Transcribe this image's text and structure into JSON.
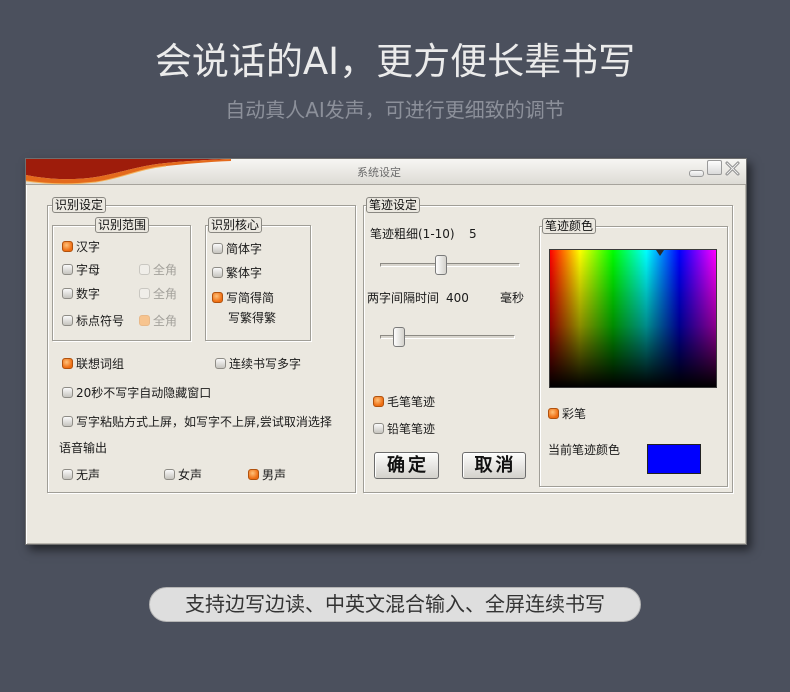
{
  "headline": "会说话的AI，更方便长辈书写",
  "subheadline": "自动真人AI发声，可进行更细致的调节",
  "dialog": {
    "title": "系统设定",
    "window_controls": {
      "minimize_icon": "minimize-icon",
      "maximize_icon": "maximize-icon",
      "close_icon": "close-icon"
    },
    "recognition": {
      "title": "识别设定",
      "range": {
        "title": "识别范围",
        "hanzi": {
          "label": "汉字",
          "checked": true
        },
        "letters": {
          "label": "字母",
          "checked": false
        },
        "letters_fullwidth": {
          "label": "全角",
          "checked": false,
          "disabled": true
        },
        "digits": {
          "label": "数字",
          "checked": false
        },
        "digits_fullwidth": {
          "label": "全角",
          "checked": false,
          "disabled": true
        },
        "punctuation": {
          "label": "标点符号",
          "checked": false
        },
        "punctuation_fullwidth": {
          "label": "全角",
          "checked": true,
          "disabled": true
        }
      },
      "core": {
        "title": "识别核心",
        "simplified": {
          "label": "简体字",
          "checked": false
        },
        "traditional": {
          "label": "繁体字",
          "checked": false
        },
        "write_simplified": {
          "label": "写简得简",
          "checked": true
        },
        "write_traditional": {
          "label": "写繁得繁"
        }
      },
      "association": {
        "label": "联想词组",
        "checked": true
      },
      "continuous": {
        "label": "连续书写多字",
        "checked": false
      },
      "auto_hide": {
        "label": "20秒不写字自动隐藏窗口",
        "checked": false
      },
      "paste_mode": {
        "label": "写字粘贴方式上屏，如写字不上屏,尝试取消选择",
        "checked": false
      },
      "voice": {
        "title": "语音输出",
        "none": {
          "label": "无声",
          "checked": false
        },
        "female": {
          "label": "女声",
          "checked": false
        },
        "male": {
          "label": "男声",
          "checked": true
        }
      }
    },
    "stroke": {
      "title": "笔迹设定",
      "thickness": {
        "label": "笔迹粗细(1-10)",
        "value": "5",
        "level_percent": 44
      },
      "interval": {
        "label": "两字间隔时间",
        "value": "400",
        "unit": "毫秒",
        "level_percent": 15
      },
      "color": {
        "title": "笔迹颜色",
        "rainbow": {
          "label": "彩笔",
          "checked": true
        },
        "current_label": "当前笔迹颜色",
        "current_color": "#0000fe"
      },
      "brush": {
        "label": "毛笔笔迹",
        "checked": true
      },
      "pencil": {
        "label": "铅笔笔迹",
        "checked": false
      },
      "ok_label": "确定",
      "cancel_label": "取消"
    }
  },
  "footer_pill": "支持边写边读、中英文混合输入、全屏连续书写",
  "colors": {
    "page_background": "#4b505d",
    "dialog_background": "#ebe8e0",
    "accent": "#ee6d12"
  }
}
